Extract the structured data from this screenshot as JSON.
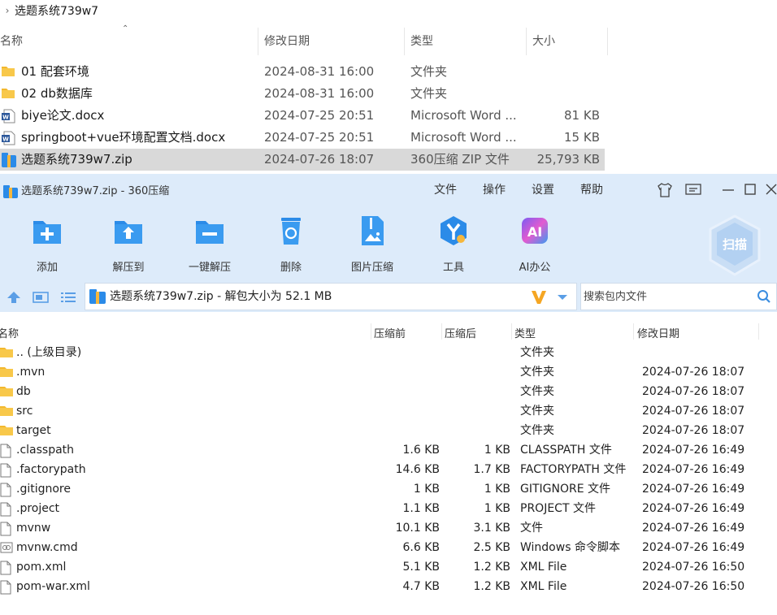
{
  "explorer": {
    "breadcrumb": "选题系统739w7",
    "columns": {
      "name": "名称",
      "modified": "修改日期",
      "type": "类型",
      "size": "大小"
    },
    "rows": [
      {
        "name": "01 配套环境",
        "date": "2024-08-31 16:00",
        "type": "文件夹",
        "size": "",
        "icon": "folder-icon"
      },
      {
        "name": "02 db数据库",
        "date": "2024-08-31 16:00",
        "type": "文件夹",
        "size": "",
        "icon": "folder-icon"
      },
      {
        "name": "biye论文.docx",
        "date": "2024-07-25 20:51",
        "type": "Microsoft Word ...",
        "size": "81 KB",
        "icon": "word-doc-icon"
      },
      {
        "name": "springboot+vue环境配置文档.docx",
        "date": "2024-07-25 20:51",
        "type": "Microsoft Word ...",
        "size": "15 KB",
        "icon": "word-doc-icon"
      },
      {
        "name": "选题系统739w7.zip",
        "date": "2024-07-26 18:07",
        "type": "360压缩 ZIP 文件",
        "size": "25,793 KB",
        "icon": "zip-archive-icon",
        "selected": true
      }
    ]
  },
  "app": {
    "title": "选题系统739w7.zip - 360压缩",
    "menu": [
      "文件",
      "操作",
      "设置",
      "帮助"
    ],
    "toolbar": [
      {
        "label": "添加",
        "icon": "add-icon"
      },
      {
        "label": "解压到",
        "icon": "extract-to-icon"
      },
      {
        "label": "一键解压",
        "icon": "one-click-extract-icon"
      },
      {
        "label": "删除",
        "icon": "recycle-bin-icon"
      },
      {
        "label": "图片压缩",
        "icon": "image-compress-icon"
      },
      {
        "label": "工具",
        "icon": "tools-icon"
      },
      {
        "label": "AI办公",
        "icon": "ai-office-icon"
      }
    ],
    "scan_label": "扫描",
    "address": "选题系统739w7.zip - 解包大小为 52.1 MB",
    "search_placeholder": "搜索包内文件",
    "columns": {
      "name": "名称",
      "packed": "压缩前",
      "compressed": "压缩后",
      "type": "类型",
      "modified": "修改日期"
    },
    "files": [
      {
        "name": ".. (上级目录)",
        "before": "",
        "after": "",
        "type": "文件夹",
        "date": "",
        "icon": "folder-icon"
      },
      {
        "name": ".mvn",
        "before": "",
        "after": "",
        "type": "文件夹",
        "date": "2024-07-26 18:07",
        "icon": "folder-icon"
      },
      {
        "name": "db",
        "before": "",
        "after": "",
        "type": "文件夹",
        "date": "2024-07-26 18:07",
        "icon": "folder-icon"
      },
      {
        "name": "src",
        "before": "",
        "after": "",
        "type": "文件夹",
        "date": "2024-07-26 18:07",
        "icon": "folder-icon"
      },
      {
        "name": "target",
        "before": "",
        "after": "",
        "type": "文件夹",
        "date": "2024-07-26 18:07",
        "icon": "folder-icon"
      },
      {
        "name": ".classpath",
        "before": "1.6 KB",
        "after": "1 KB",
        "type": "CLASSPATH 文件",
        "date": "2024-07-26 16:49",
        "icon": "file-icon"
      },
      {
        "name": ".factorypath",
        "before": "14.6 KB",
        "after": "1.7 KB",
        "type": "FACTORYPATH 文件",
        "date": "2024-07-26 16:49",
        "icon": "file-icon"
      },
      {
        "name": ".gitignore",
        "before": "1 KB",
        "after": "1 KB",
        "type": "GITIGNORE 文件",
        "date": "2024-07-26 16:49",
        "icon": "file-icon"
      },
      {
        "name": ".project",
        "before": "1.1 KB",
        "after": "1 KB",
        "type": "PROJECT 文件",
        "date": "2024-07-26 16:49",
        "icon": "file-icon"
      },
      {
        "name": "mvnw",
        "before": "10.1 KB",
        "after": "3.1 KB",
        "type": "文件",
        "date": "2024-07-26 16:49",
        "icon": "file-icon"
      },
      {
        "name": "mvnw.cmd",
        "before": "6.6 KB",
        "after": "2.5 KB",
        "type": "Windows 命令脚本",
        "date": "2024-07-26 16:49",
        "icon": "script-file-icon"
      },
      {
        "name": "pom.xml",
        "before": "5.1 KB",
        "after": "1.2 KB",
        "type": "XML File",
        "date": "2024-07-26 16:50",
        "icon": "file-icon"
      },
      {
        "name": "pom-war.xml",
        "before": "4.7 KB",
        "after": "1.2 KB",
        "type": "XML File",
        "date": "2024-07-26 16:50",
        "icon": "file-icon"
      }
    ]
  }
}
